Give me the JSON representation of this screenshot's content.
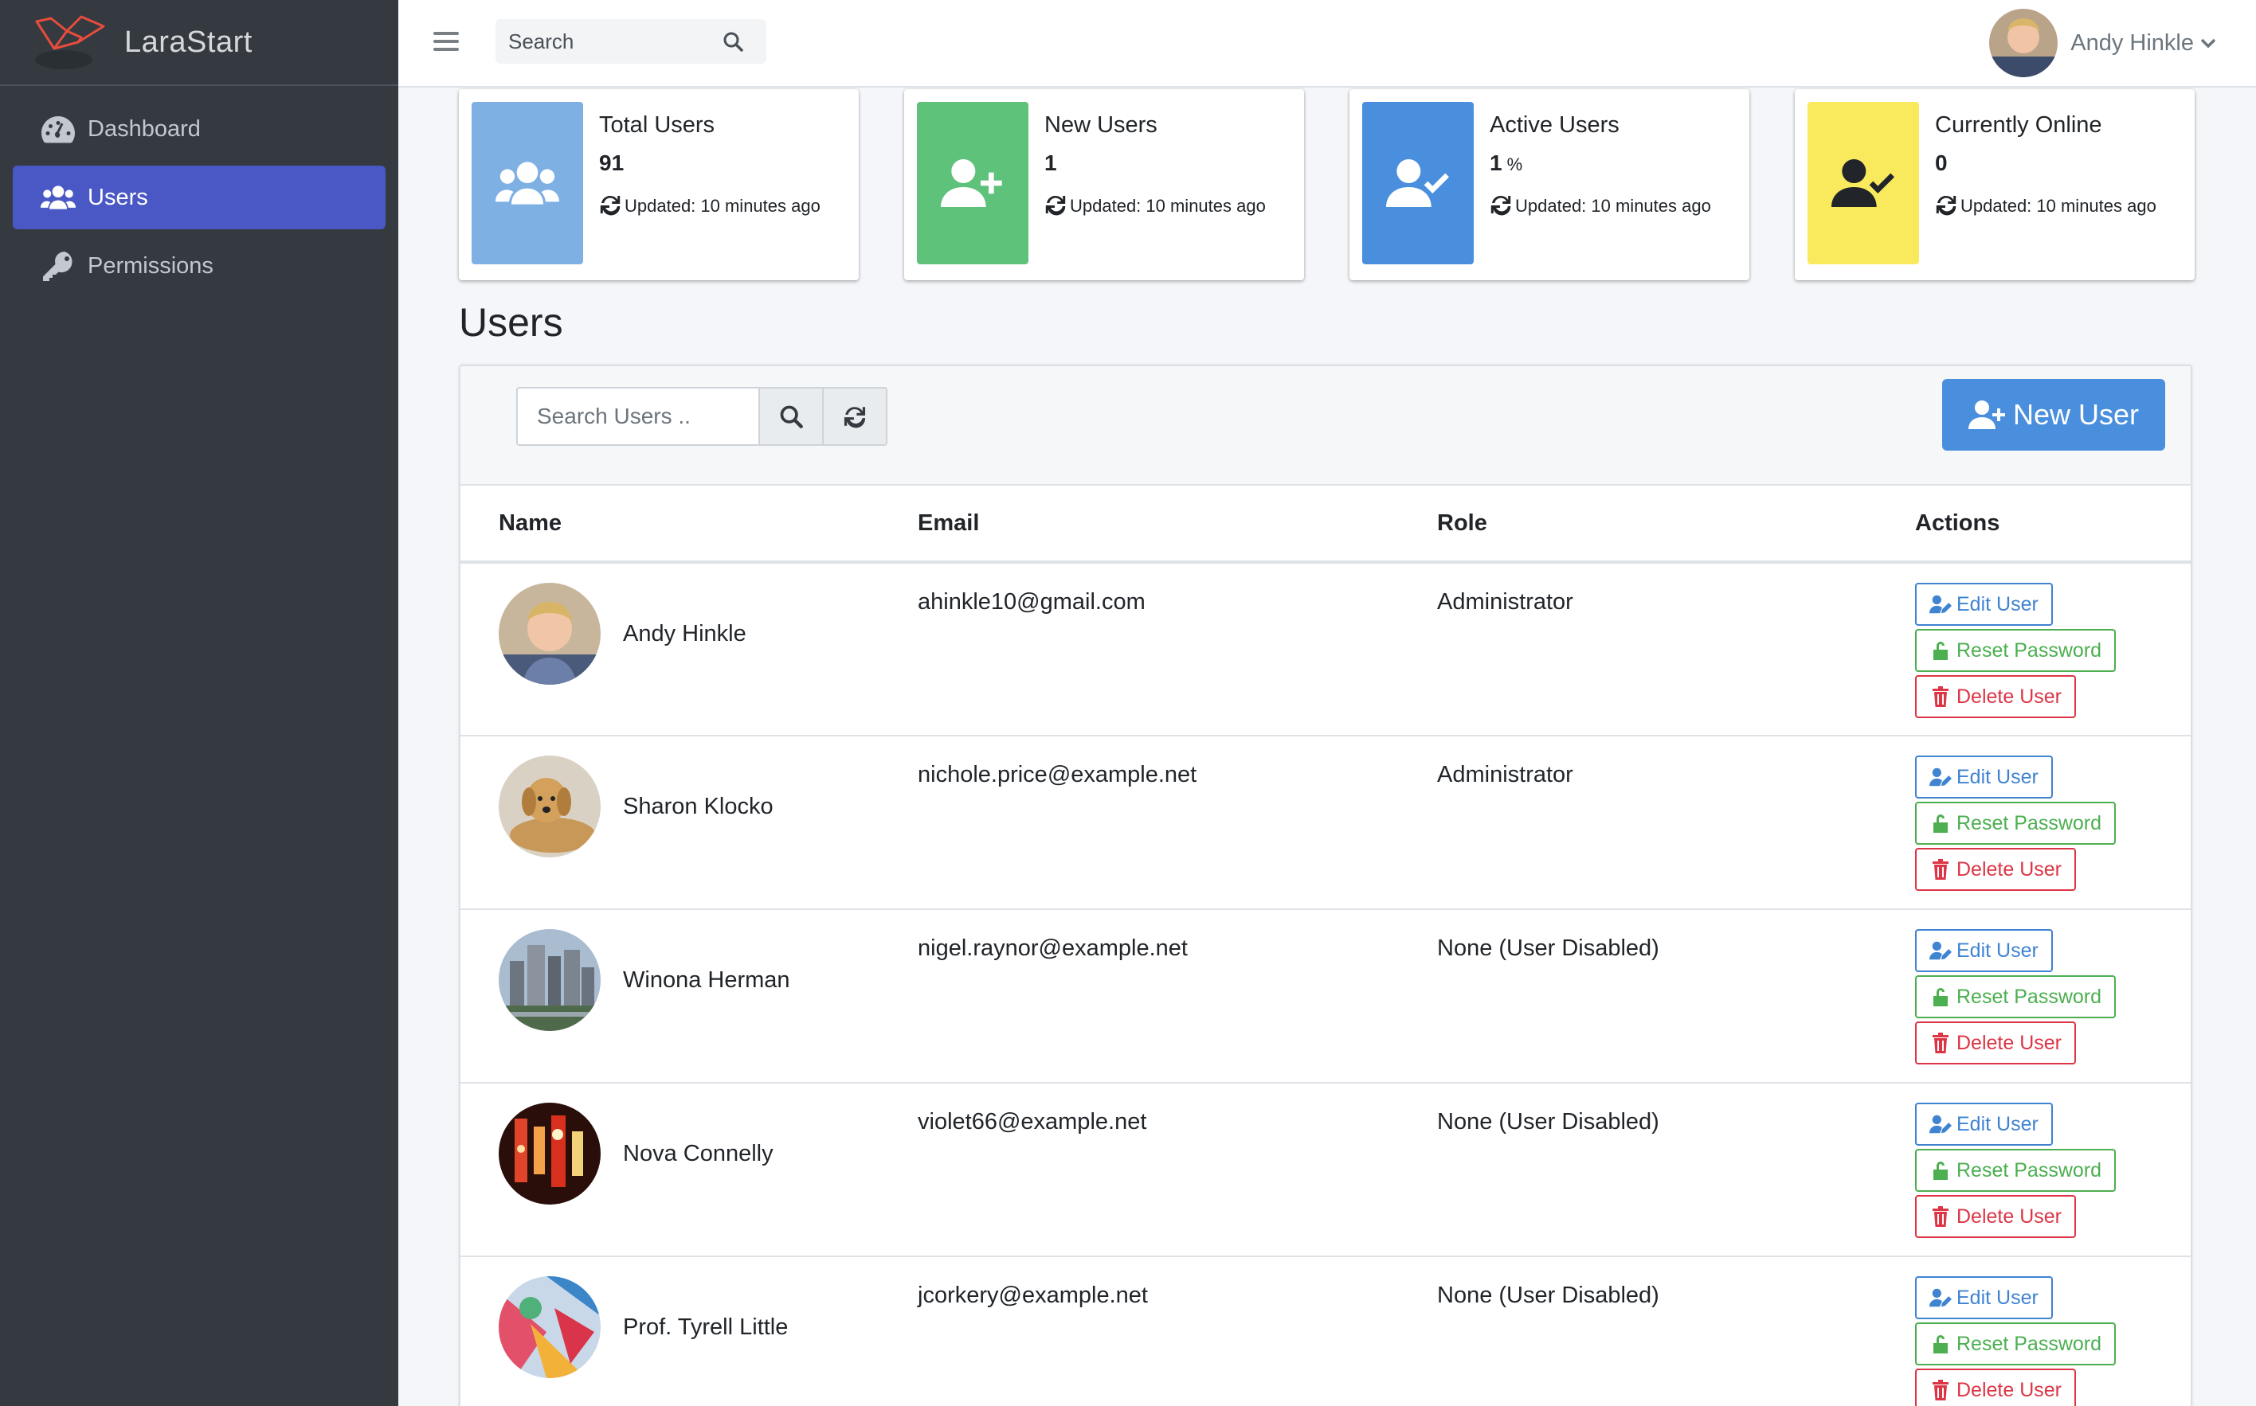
{
  "app": {
    "brand": "LaraStart"
  },
  "sidebar": {
    "items": [
      {
        "label": "Dashboard",
        "icon": "tachometer-icon",
        "active": false
      },
      {
        "label": "Users",
        "icon": "users-icon",
        "active": true
      },
      {
        "label": "Permissions",
        "icon": "key-icon",
        "active": false
      }
    ]
  },
  "topbar": {
    "search_placeholder": "Search",
    "user_name": "Andy Hinkle"
  },
  "stats": [
    {
      "title": "Total Users",
      "value": "91",
      "unit": "",
      "updated": "Updated: 10 minutes ago",
      "color": "#7fb0e4",
      "icon": "users-icon"
    },
    {
      "title": "New Users",
      "value": "1",
      "unit": "",
      "updated": "Updated: 10 minutes ago",
      "color": "#5ec27a",
      "icon": "user-plus-icon"
    },
    {
      "title": "Active Users",
      "value": "1",
      "unit": "%",
      "updated": "Updated: 10 minutes ago",
      "color": "#4a8fdd",
      "icon": "user-check-icon"
    },
    {
      "title": "Currently Online",
      "value": "0",
      "unit": "",
      "updated": "Updated: 10 minutes ago",
      "color": "#f8ea5c",
      "icon": "user-check-icon"
    }
  ],
  "users_section": {
    "title": "Users",
    "search_placeholder": "Search Users ..",
    "new_user_label": "New User",
    "columns": {
      "name": "Name",
      "email": "Email",
      "role": "Role",
      "actions": "Actions"
    },
    "action_labels": {
      "edit": "Edit User",
      "reset": "Reset Password",
      "delete": "Delete User"
    },
    "rows": [
      {
        "name": "Andy Hinkle",
        "email": "ahinkle10@gmail.com",
        "role": "Administrator",
        "avatar": "person-photo"
      },
      {
        "name": "Sharon Klocko",
        "email": "nichole.price@example.net",
        "role": "Administrator",
        "avatar": "puppy-photo"
      },
      {
        "name": "Winona Herman",
        "email": "nigel.raynor@example.net",
        "role": "None (User Disabled)",
        "avatar": "city-photo"
      },
      {
        "name": "Nova Connelly",
        "email": "violet66@example.net",
        "role": "None (User Disabled)",
        "avatar": "neon-photo"
      },
      {
        "name": "Prof. Tyrell Little",
        "email": "jcorkery@example.net",
        "role": "None (User Disabled)",
        "avatar": "abstract-art-photo"
      }
    ]
  }
}
